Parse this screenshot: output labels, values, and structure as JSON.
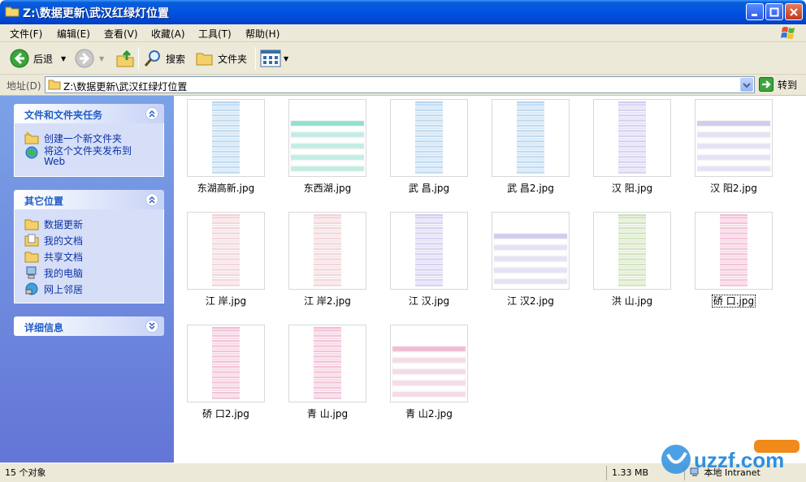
{
  "window": {
    "title": "Z:\\数据更新\\武汉红绿灯位置"
  },
  "menu": [
    "文件(F)",
    "编辑(E)",
    "查看(V)",
    "收藏(A)",
    "工具(T)",
    "帮助(H)"
  ],
  "toolbar": {
    "back": "后退",
    "search": "搜索",
    "folders": "文件夹"
  },
  "address": {
    "label": "地址(D)",
    "path": "Z:\\数据更新\\武汉红绿灯位置",
    "go": "转到"
  },
  "tasks_panel": {
    "title": "文件和文件夹任务",
    "items": [
      "创建一个新文件夹",
      "将这个文件夹发布到 Web"
    ]
  },
  "places_panel": {
    "title": "其它位置",
    "items": [
      "数据更新",
      "我的文档",
      "共享文档",
      "我的电脑",
      "网上邻居"
    ]
  },
  "details_panel": {
    "title": "详细信息"
  },
  "files": [
    {
      "name": "东湖高新.jpg",
      "style": "narrow",
      "color": "#b7d6f0"
    },
    {
      "name": "东西湖.jpg",
      "style": "table",
      "color": "#8fe0cf"
    },
    {
      "name": "武 昌.jpg",
      "style": "narrow",
      "color": "#b7d6f0"
    },
    {
      "name": "武 昌2.jpg",
      "style": "narrow",
      "color": "#b7d6f0"
    },
    {
      "name": "汉 阳.jpg",
      "style": "narrow",
      "color": "#d2ccf0"
    },
    {
      "name": "汉 阳2.jpg",
      "style": "table",
      "color": "#d2ccf0"
    },
    {
      "name": "江 岸.jpg",
      "style": "narrow",
      "color": "#f0d2d6"
    },
    {
      "name": "江 岸2.jpg",
      "style": "narrow",
      "color": "#f0d2d6"
    },
    {
      "name": "江 汉.jpg",
      "style": "narrow",
      "color": "#d2ccf0"
    },
    {
      "name": "江 汉2.jpg",
      "style": "table",
      "color": "#d2ccf0"
    },
    {
      "name": "洪 山.jpg",
      "style": "narrow",
      "color": "#cde0b8"
    },
    {
      "name": "硚 口.jpg",
      "style": "narrow",
      "color": "#f2bcd4",
      "selected": true
    },
    {
      "name": "硚 口2.jpg",
      "style": "narrow",
      "color": "#f2bcd4"
    },
    {
      "name": "青 山.jpg",
      "style": "narrow",
      "color": "#f2bcd4"
    },
    {
      "name": "青 山2.jpg",
      "style": "table",
      "color": "#f2bcd4"
    }
  ],
  "status": {
    "count": "15 个对象",
    "size": "1.33 MB",
    "zone": "本地 Intranet"
  },
  "watermark": "uzzf.com"
}
